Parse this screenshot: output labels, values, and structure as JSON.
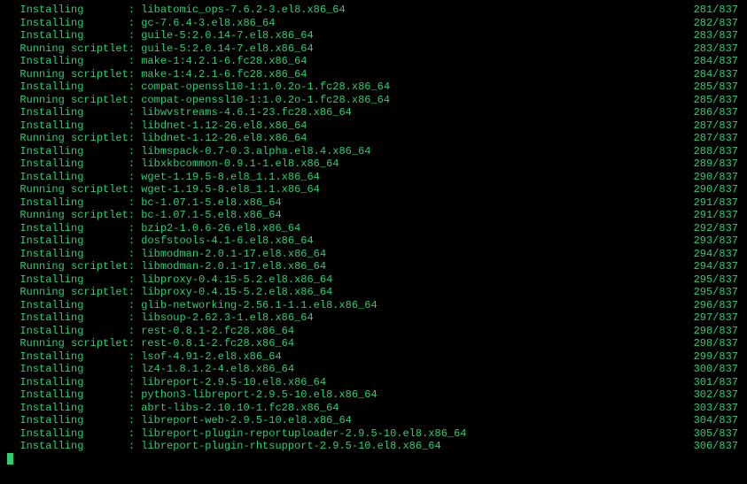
{
  "lines": [
    {
      "action": "Installing       ",
      "package": "libatomic_ops-7.6.2-3.el8.x86_64",
      "counter": "281/837"
    },
    {
      "action": "Installing       ",
      "package": "gc-7.6.4-3.el8.x86_64",
      "counter": "282/837"
    },
    {
      "action": "Installing       ",
      "package": "guile-5:2.0.14-7.el8.x86_64",
      "counter": "283/837"
    },
    {
      "action": "Running scriptlet",
      "package": "guile-5:2.0.14-7.el8.x86_64",
      "counter": "283/837"
    },
    {
      "action": "Installing       ",
      "package": "make-1:4.2.1-6.fc28.x86_64",
      "counter": "284/837"
    },
    {
      "action": "Running scriptlet",
      "package": "make-1:4.2.1-6.fc28.x86_64",
      "counter": "284/837"
    },
    {
      "action": "Installing       ",
      "package": "compat-openssl10-1:1.0.2o-1.fc28.x86_64",
      "counter": "285/837"
    },
    {
      "action": "Running scriptlet",
      "package": "compat-openssl10-1:1.0.2o-1.fc28.x86_64",
      "counter": "285/837"
    },
    {
      "action": "Installing       ",
      "package": "libwvstreams-4.6.1-23.fc28.x86_64",
      "counter": "286/837"
    },
    {
      "action": "Installing       ",
      "package": "libdnet-1.12-26.el8.x86_64",
      "counter": "287/837"
    },
    {
      "action": "Running scriptlet",
      "package": "libdnet-1.12-26.el8.x86_64",
      "counter": "287/837"
    },
    {
      "action": "Installing       ",
      "package": "libmspack-0.7-0.3.alpha.el8.4.x86_64",
      "counter": "288/837"
    },
    {
      "action": "Installing       ",
      "package": "libxkbcommon-0.9.1-1.el8.x86_64",
      "counter": "289/837"
    },
    {
      "action": "Installing       ",
      "package": "wget-1.19.5-8.el8_1.1.x86_64",
      "counter": "290/837"
    },
    {
      "action": "Running scriptlet",
      "package": "wget-1.19.5-8.el8_1.1.x86_64",
      "counter": "290/837"
    },
    {
      "action": "Installing       ",
      "package": "bc-1.07.1-5.el8.x86_64",
      "counter": "291/837"
    },
    {
      "action": "Running scriptlet",
      "package": "bc-1.07.1-5.el8.x86_64",
      "counter": "291/837"
    },
    {
      "action": "Installing       ",
      "package": "bzip2-1.0.6-26.el8.x86_64",
      "counter": "292/837"
    },
    {
      "action": "Installing       ",
      "package": "dosfstools-4.1-6.el8.x86_64",
      "counter": "293/837"
    },
    {
      "action": "Installing       ",
      "package": "libmodman-2.0.1-17.el8.x86_64",
      "counter": "294/837"
    },
    {
      "action": "Running scriptlet",
      "package": "libmodman-2.0.1-17.el8.x86_64",
      "counter": "294/837"
    },
    {
      "action": "Installing       ",
      "package": "libproxy-0.4.15-5.2.el8.x86_64",
      "counter": "295/837"
    },
    {
      "action": "Running scriptlet",
      "package": "libproxy-0.4.15-5.2.el8.x86_64",
      "counter": "295/837"
    },
    {
      "action": "Installing       ",
      "package": "glib-networking-2.56.1-1.1.el8.x86_64",
      "counter": "296/837"
    },
    {
      "action": "Installing       ",
      "package": "libsoup-2.62.3-1.el8.x86_64",
      "counter": "297/837"
    },
    {
      "action": "Installing       ",
      "package": "rest-0.8.1-2.fc28.x86_64",
      "counter": "298/837"
    },
    {
      "action": "Running scriptlet",
      "package": "rest-0.8.1-2.fc28.x86_64",
      "counter": "298/837"
    },
    {
      "action": "Installing       ",
      "package": "lsof-4.91-2.el8.x86_64",
      "counter": "299/837"
    },
    {
      "action": "Installing       ",
      "package": "lz4-1.8.1.2-4.el8.x86_64",
      "counter": "300/837"
    },
    {
      "action": "Installing       ",
      "package": "libreport-2.9.5-10.el8.x86_64",
      "counter": "301/837"
    },
    {
      "action": "Installing       ",
      "package": "python3-libreport-2.9.5-10.el8.x86_64",
      "counter": "302/837"
    },
    {
      "action": "Installing       ",
      "package": "abrt-libs-2.10.10-1.fc28.x86_64",
      "counter": "303/837"
    },
    {
      "action": "Installing       ",
      "package": "libreport-web-2.9.5-10.el8.x86_64",
      "counter": "304/837"
    },
    {
      "action": "Installing       ",
      "package": "libreport-plugin-reportuploader-2.9.5-10.el8.x86_64",
      "counter": "305/837"
    },
    {
      "action": "Installing       ",
      "package": "libreport-plugin-rhtsupport-2.9.5-10.el8.x86_64",
      "counter": "306/837"
    }
  ],
  "separator": ": "
}
